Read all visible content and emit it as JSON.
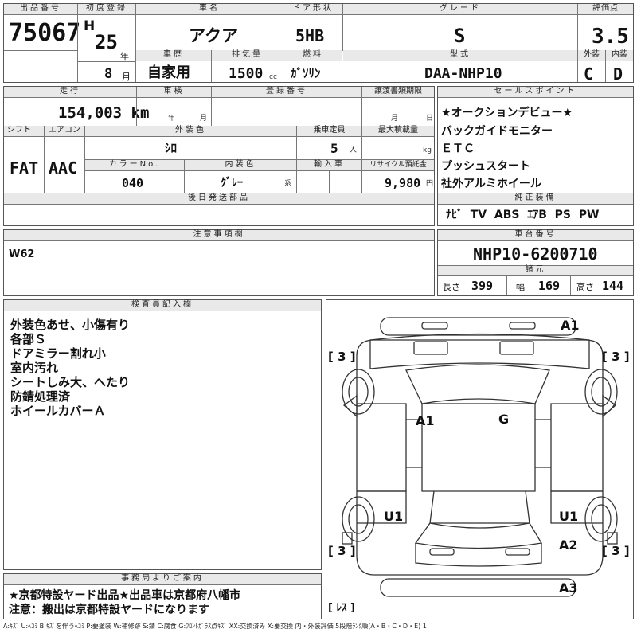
{
  "header": {
    "lot_label": "出品番号",
    "lot_no": "75067",
    "first_reg_label": "初度登録",
    "era": "H",
    "year": "25",
    "year_unit": "年",
    "month": "8",
    "month_unit": "月",
    "car_name_label": "車名",
    "car_name": "アクア",
    "door_label": "ドア形状",
    "door": "5HB",
    "grade_label": "グレード",
    "grade": "S",
    "score_label": "評価点",
    "score": "3.5",
    "history_label": "車歴",
    "history": "自家用",
    "disp_label": "排気量",
    "disp": "1500",
    "disp_unit": "cc",
    "fuel_label": "燃料",
    "fuel": "ｶﾞｿﾘﾝ",
    "model_label": "型式",
    "model": "DAA-NHP10",
    "ext_label": "外装",
    "ext": "C",
    "int_label": "内装",
    "int": "D"
  },
  "row2": {
    "mileage_label": "走行",
    "mileage": "154,003 km",
    "inspect_label": "車検",
    "inspect_y": "年",
    "inspect_m": "月",
    "regno_label": "登録番号",
    "transfer_label": "譲渡書類期限",
    "transfer_m": "月",
    "transfer_d": "日",
    "shift_label": "シフト",
    "shift": "FAT",
    "ac_label": "エアコン",
    "ac": "AAC",
    "color_label": "外装色",
    "color": "ｼﾛ",
    "capacity_label": "乗車定員",
    "capacity": "5",
    "capacity_unit": "人",
    "load_label": "最大積載量",
    "load_unit": "kg",
    "colorno_label": "カラーNo.",
    "colorno": "040",
    "intcolor_label": "内装色",
    "intcolor": "ｸﾞﾚｰ",
    "intcolor_unit": "系",
    "import_label": "輸入車",
    "recycle_label": "リサイクル預託金",
    "recycle": "9,980",
    "recycle_unit": "円",
    "later_label": "後日発送部品"
  },
  "sales_points": {
    "label": "セールスポイント",
    "items": [
      "★オークションデビュー★",
      "バックガイドモニター",
      "ＥＴＣ",
      "プッシュスタート",
      "社外アルミホイール"
    ]
  },
  "equipment": {
    "label": "純正装備",
    "items": "ﾅﾋﾞ  TV  ABS  ｴｱB  PS  PW"
  },
  "notes": {
    "label": "注意事項欄",
    "text": "W62"
  },
  "chassis": {
    "label": "車台番号",
    "number": "NHP10-6200710",
    "spec_label": "諸元",
    "length_label": "長さ",
    "length": "399",
    "width_label": "幅",
    "width": "169",
    "height_label": "高さ",
    "height": "144"
  },
  "inspector": {
    "label": "検査員記入欄",
    "lines": [
      "外装色あせ、小傷有り",
      "各部Ｓ",
      "ドアミラー割れ小",
      "室内汚れ",
      "シートしみ大、へたり",
      "防錆処理済",
      "ホイールカバーＡ"
    ]
  },
  "diagram": {
    "marks": [
      "A1",
      "A1",
      "G",
      "U1",
      "U1",
      "A2",
      "A3"
    ],
    "tires": [
      "[ 3 ]",
      "[ 3 ]",
      "[ 3 ]",
      "[ 3 ]"
    ],
    "spare": "[ ﾚｽ ]"
  },
  "office": {
    "label": "事務局よりご案内",
    "line1": "★京都特設ヤード出品★出品車は京都府八幡市",
    "line2": "注意：搬出は京都特設ヤードになります"
  },
  "legend": "A:ｷｽﾞ  U:ﾍｺﾐ  B:ｷｽﾞを伴うﾍｺﾐ  P:要塗装  W:補修跡  S:錆  C:腐食  G:ﾌﾛﾝﾄｶﾞﾗｽ点ｷｽﾞ  XX:交換済み  X:要交換   内・外装評価  5段階ﾗﾝｸ順(A・B・C・D・E) 1"
}
